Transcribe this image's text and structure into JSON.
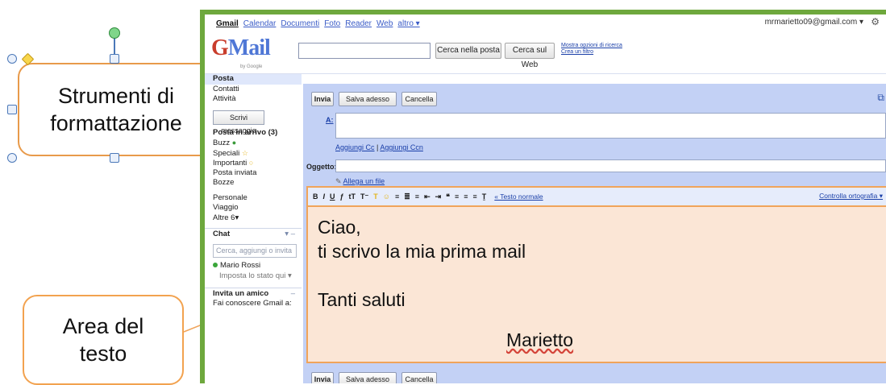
{
  "annotations": {
    "formatting_tools": "Strumenti di\nformattazione",
    "formatting_tools_line1": "Strumenti di",
    "formatting_tools_line2": "formattazione",
    "text_area_line1": "Area del",
    "text_area_line2": "testo"
  },
  "topnav": {
    "links": [
      "Gmail",
      "Calendar",
      "Documenti",
      "Foto",
      "Reader",
      "Web",
      "altro ▾"
    ],
    "account": "mrmarietto09@gmail.com ▾",
    "settings_icon": "gear-icon"
  },
  "header": {
    "logo_text": "Mail",
    "logo_g": "G",
    "logo_sub": "by Google",
    "search_value": "",
    "search_mail_button": "Cerca nella posta",
    "search_web_button": "Cerca sul Web",
    "show_search_options": "Mostra opzioni di ricerca",
    "create_filter": "Crea un filtro"
  },
  "sidebar": {
    "top_items": [
      "Posta",
      "Contatti",
      "Attività"
    ],
    "compose_button": "Scrivi messaggio",
    "folders": [
      {
        "label": "Posta in arrivo (3)",
        "icon": ""
      },
      {
        "label": "Buzz",
        "icon": "buzz-icon"
      },
      {
        "label": "Speciali",
        "icon": "star-icon"
      },
      {
        "label": "Importanti",
        "icon": "importance-icon"
      },
      {
        "label": "Posta inviata",
        "icon": ""
      },
      {
        "label": "Bozze",
        "icon": ""
      }
    ],
    "labels": [
      "Personale",
      "Viaggio",
      "Altre 6▾"
    ],
    "chat": {
      "header": "Chat",
      "search_placeholder": "Cerca, aggiungi o invita",
      "contact": "Mario Rossi",
      "status": "Imposta lo stato qui ▾"
    },
    "invite": {
      "header": "Invita un amico",
      "text": "Fai conoscere Gmail a:"
    }
  },
  "compose": {
    "send": "Invia",
    "save": "Salva adesso",
    "cancel": "Cancella",
    "to_label": "A:",
    "to_value": "",
    "add_cc": "Aggiungi Cc",
    "add_bcc": "Aggiungi Ccn",
    "cc_separator": " | ",
    "subject_label": "Oggetto:",
    "subject_value": "",
    "attach_file": "Allega un file",
    "plain_text_link": "« Testo normale",
    "spellcheck": "Controlla ortografia ▾",
    "body_lines": [
      "Ciao,",
      "ti scrivo la mia prima mail",
      "",
      "Tanti saluti"
    ],
    "signature": "Marietto"
  },
  "colors": {
    "accent_orange": "#f0a45a",
    "compose_bg": "#c3d1f5",
    "body_bg": "#fbe6d6",
    "frame_green": "#6ea83d"
  }
}
